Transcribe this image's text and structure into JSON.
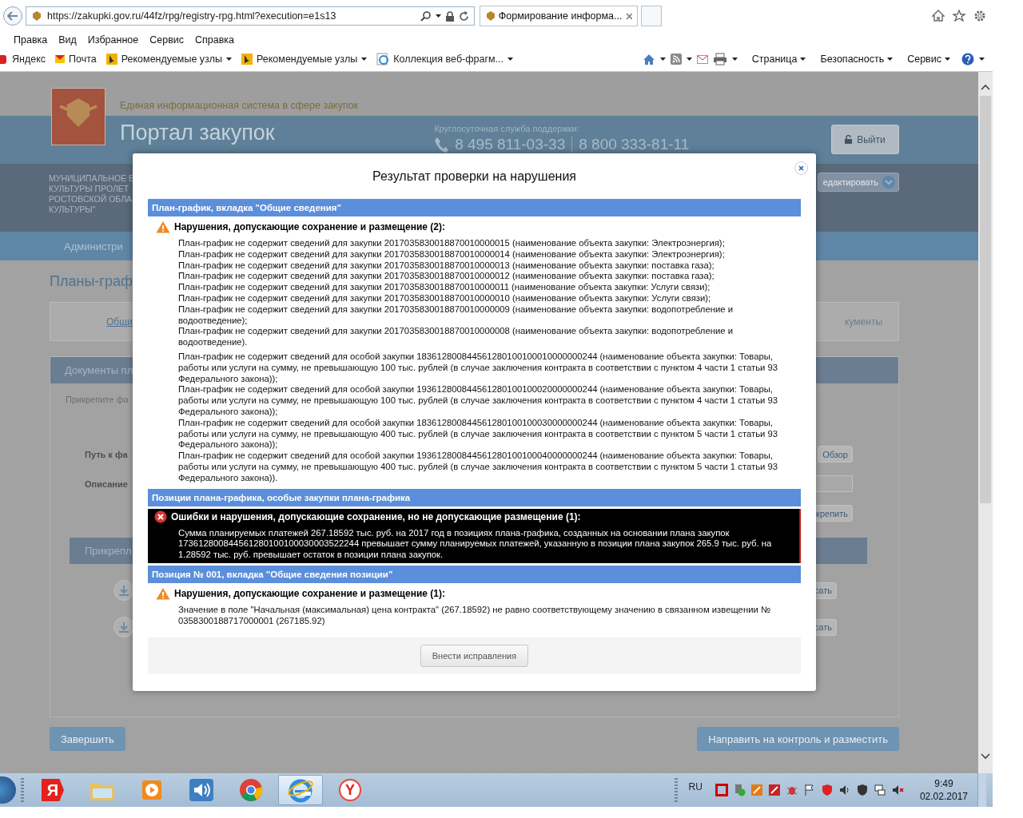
{
  "browser": {
    "url": "https://zakupki.gov.ru/44fz/rpg/registry-rpg.html?execution=e1s13",
    "tab_title": "Формирование информа...",
    "menu": [
      "Правка",
      "Вид",
      "Избранное",
      "Сервис",
      "Справка"
    ],
    "favorites": [
      {
        "label": "Яндекс",
        "kind": "yandex"
      },
      {
        "label": "Почта",
        "kind": "mail"
      },
      {
        "label": "Рекомендуемые узлы",
        "kind": "bing"
      },
      {
        "label": "Рекомендуемые узлы",
        "kind": "bing"
      },
      {
        "label": "Коллекция веб-фрагм...",
        "kind": "ie"
      }
    ],
    "commands": [
      "Страница",
      "Безопасность",
      "Сервис"
    ]
  },
  "page": {
    "eis_title": "Единая информационная система в сфере закупок",
    "portal_title": "Портал закупок",
    "support_label": "Круглосуточная служба поддержки:",
    "phones": [
      "8 495 811-03-33",
      "8 800 333-81-11"
    ],
    "logout": "Выйти",
    "org_lines": [
      "МУНИЦИПАЛЬНОЕ Б",
      "КУЛЬТУРЫ ПРОЛЕТ",
      "РОСТОВСКОЙ ОБЛА",
      "КУЛЬТУРЫ\""
    ],
    "edit_button": "едактировать",
    "nav_item": "Администри",
    "heading": "Планы-граф",
    "tab_left": "Общи",
    "tab_right": "кументы",
    "docs_panel": {
      "title": "Документы пл",
      "hint": "Прикрепите фа",
      "path_label": "Путь к фа",
      "browse_button": "Обзор",
      "description_label": "Описание",
      "attach_button": "крепить",
      "attached_title": "Прикрепл",
      "row_buttons": [
        "сать",
        "сать"
      ]
    },
    "finish_button": "Завершить",
    "publish_button": "Направить на контроль и разместить"
  },
  "dialog": {
    "title": "Результат проверки на нарушения",
    "sections": [
      {
        "heading": "План-график, вкладка \"Общие сведения\"",
        "groups": [
          {
            "kind": "warning",
            "title": "Нарушения, допускающие сохранение и размещение (2):",
            "blocks": [
              [
                "План-график не содержит сведений для закупки 2017035830018870010000015 (наименование объекта закупки: Электроэнергия);",
                "План-график не содержит сведений для закупки 2017035830018870010000014 (наименование объекта закупки: Электроэнергия);",
                "План-график не содержит сведений для закупки 2017035830018870010000013 (наименование объекта закупки: поставка газа);",
                "План-график не содержит сведений для закупки 2017035830018870010000012 (наименование объекта закупки: поставка газа);",
                "План-график не содержит сведений для закупки 2017035830018870010000011 (наименование объекта закупки: Услуги связи);",
                "План-график не содержит сведений для закупки 2017035830018870010000010 (наименование объекта закупки: Услуги связи);",
                "План-график не содержит сведений для закупки 2017035830018870010000009 (наименование объекта закупки: водопотребление и водоотведение);",
                "План-график не содержит сведений для закупки 2017035830018870010000008 (наименование объекта закупки: водопотребление и водоотведение)."
              ],
              [
                "План-график не содержит сведений для особой закупки 183612800844561280100100010000000244 (наименование объекта закупки: Товары, работы или услуги на сумму, не превышающую 100 тыс. рублей (в случае заключения контракта в соответствии с пунктом 4 части 1 статьи 93 Федерального закона));",
                "План-график не содержит сведений для особой закупки 193612800844561280100100020000000244 (наименование объекта закупки: Товары, работы или услуги на сумму, не превышающую 100 тыс. рублей (в случае заключения контракта в соответствии с пунктом 4 части 1 статьи 93 Федерального закона));",
                "План-график не содержит сведений для особой закупки 183612800844561280100100030000000244 (наименование объекта закупки: Товары, работы или услуги на сумму, не превышающую 400 тыс. рублей (в случае заключения контракта в соответствии с пунктом 5 части 1 статьи 93 Федерального закона));",
                "План-график не содержит сведений для особой закупки 193612800844561280100100040000000244 (наименование объекта закупки: Товары, работы или услуги на сумму, не превышающую 400 тыс. рублей (в случае заключения контракта в соответствии с пунктом 5 части 1 статьи 93 Федерального закона))."
              ]
            ]
          }
        ]
      },
      {
        "heading": "Позиции плана-графика, особые закупки плана-графика",
        "groups": [
          {
            "kind": "error",
            "title": "Ошибки и нарушения, допускающие сохранение, но не допускающие размещение (1):",
            "blocks": [
              [
                "Сумма планируемых платежей 267.18592 тыс. руб. на 2017 год в позициях плана-графика, созданных на основании плана закупок 173612800844561280100100030003522244 превышает сумму планируемых платежей, указанную в позиции плана закупок 265.9 тыс. руб. на 1.28592 тыс. руб. превышает остаток в позиции плана закупок."
              ]
            ]
          }
        ]
      },
      {
        "heading": "Позиция № 001, вкладка \"Общие сведения позиции\"",
        "groups": [
          {
            "kind": "warning",
            "title": "Нарушения, допускающие сохранение и размещение (1):",
            "blocks": [
              [
                "Значение в поле \"Начальная (максимальная) цена контракта\" (267.18592) не равно соответствующему значению в связанном извещении № 0358300188717000001 (267185.92)"
              ]
            ]
          }
        ]
      }
    ],
    "button": "Внести исправления"
  },
  "taskbar": {
    "apps": [
      {
        "kind": "yandex",
        "label": "Я",
        "selected": false
      },
      {
        "kind": "folder",
        "selected": false
      },
      {
        "kind": "media",
        "selected": false
      },
      {
        "kind": "sound",
        "selected": false
      },
      {
        "kind": "chrome",
        "selected": false
      },
      {
        "kind": "ie",
        "selected": true
      },
      {
        "kind": "ybrowser",
        "label": "Y",
        "selected": false
      }
    ],
    "language": "RU",
    "time": "9:49",
    "date": "02.02.2017"
  }
}
